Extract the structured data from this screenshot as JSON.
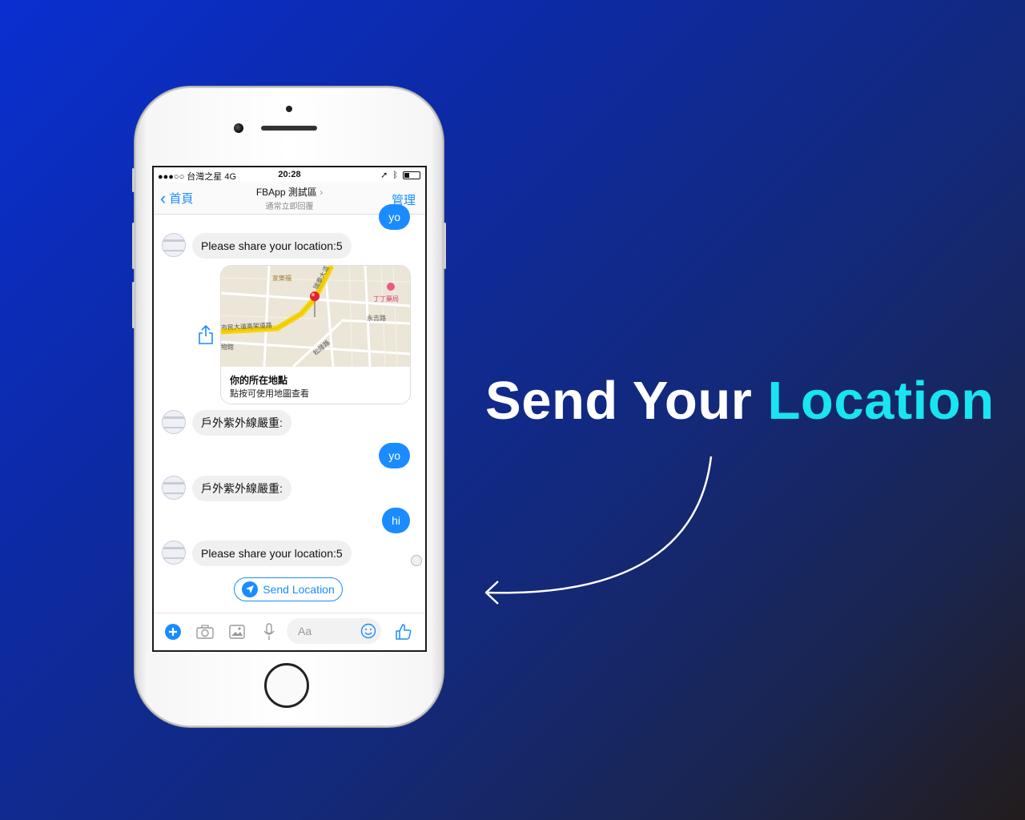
{
  "headline": {
    "part1": "Send Your",
    "part2": "Location"
  },
  "status_bar": {
    "carrier": "●●●○○ 台灣之星  4G",
    "time": "20:28"
  },
  "nav": {
    "back_label": "首頁",
    "title": "FBApp 測試區",
    "subtitle": "通常立即回覆",
    "manage_label": "管理"
  },
  "messages": [
    {
      "from": "me",
      "text": "yo"
    },
    {
      "from": "bot",
      "text": "Please share your location:5"
    },
    {
      "from": "bot",
      "type": "map",
      "map_labels": [
        "家樂福",
        "丁丁藥局",
        "永吉路",
        "市民大道高架道路",
        "物館",
        "松隆路",
        "瑞泰大道"
      ]
    },
    {
      "from": "bot",
      "text": "戶外紫外線嚴重:"
    },
    {
      "from": "me",
      "text": "yo"
    },
    {
      "from": "bot",
      "text": "戶外紫外線嚴重:"
    },
    {
      "from": "me",
      "text": "hi"
    },
    {
      "from": "bot",
      "text": "Please share your location:5"
    }
  ],
  "map_card": {
    "title": "你的所在地點",
    "subtitle": "點按可使用地圖查看"
  },
  "quick_reply": {
    "label": "Send Location"
  },
  "composer": {
    "placeholder": "Aa"
  },
  "colors": {
    "messenger_blue": "#1a8cff",
    "accent_cyan": "#19e4f0",
    "bg_blue": "#0a2fd0"
  },
  "icons": [
    "plus-icon",
    "camera-icon",
    "image-icon",
    "microphone-icon",
    "emoji-icon",
    "thumbs-up-icon",
    "share-icon",
    "location-arrow-icon"
  ]
}
